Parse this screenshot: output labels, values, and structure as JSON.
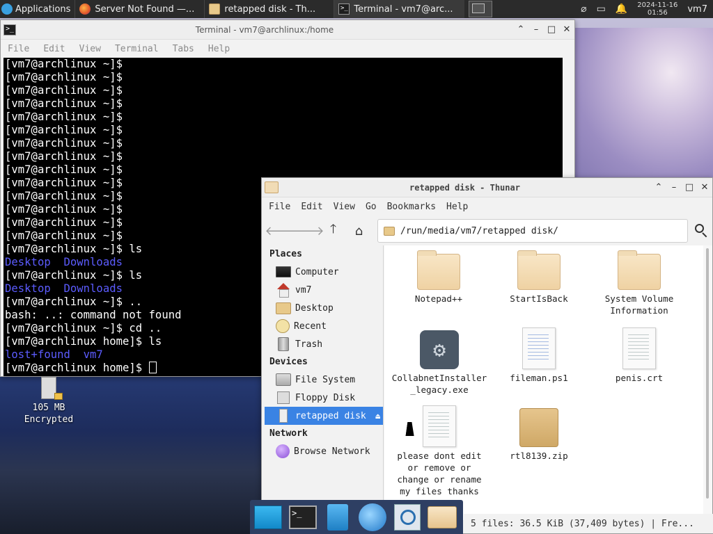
{
  "panel": {
    "apps_label": "Applications",
    "tasks": [
      {
        "label": "Server Not Found —..."
      },
      {
        "label": "retapped disk - Th..."
      },
      {
        "label": "Terminal - vm7@arc..."
      }
    ],
    "clock_date": "2024-11-16",
    "clock_time": "01:56",
    "user": "vm7"
  },
  "terminal": {
    "title": "Terminal - vm7@archlinux:/home",
    "menu": [
      "File",
      "Edit",
      "View",
      "Terminal",
      "Tabs",
      "Help"
    ],
    "lines": [
      {
        "text": "[vm7@archlinux ~]$",
        "blue": false
      },
      {
        "text": "[vm7@archlinux ~]$",
        "blue": false
      },
      {
        "text": "[vm7@archlinux ~]$",
        "blue": false
      },
      {
        "text": "[vm7@archlinux ~]$",
        "blue": false
      },
      {
        "text": "[vm7@archlinux ~]$",
        "blue": false
      },
      {
        "text": "[vm7@archlinux ~]$",
        "blue": false
      },
      {
        "text": "[vm7@archlinux ~]$",
        "blue": false
      },
      {
        "text": "[vm7@archlinux ~]$",
        "blue": false
      },
      {
        "text": "[vm7@archlinux ~]$",
        "blue": false
      },
      {
        "text": "[vm7@archlinux ~]$",
        "blue": false
      },
      {
        "text": "[vm7@archlinux ~]$",
        "blue": false
      },
      {
        "text": "[vm7@archlinux ~]$",
        "blue": false
      },
      {
        "text": "[vm7@archlinux ~]$",
        "blue": false
      },
      {
        "text": "[vm7@archlinux ~]$",
        "blue": false
      },
      {
        "text": "[vm7@archlinux ~]$ ls",
        "blue": false
      },
      {
        "text": "Desktop  Downloads",
        "blue": true
      },
      {
        "text": "[vm7@archlinux ~]$ ls",
        "blue": false
      },
      {
        "text": "Desktop  Downloads",
        "blue": true
      },
      {
        "text": "[vm7@archlinux ~]$ ..",
        "blue": false
      },
      {
        "text": "bash: ..: command not found",
        "blue": false
      },
      {
        "text": "[vm7@archlinux ~]$ cd ..",
        "blue": false
      },
      {
        "text": "[vm7@archlinux home]$ ls",
        "blue": false
      },
      {
        "text": "lost+found  vm7",
        "blue": true
      }
    ],
    "prompt": "[vm7@archlinux home]$ "
  },
  "thunar": {
    "title": "retapped disk - Thunar",
    "menu": [
      "File",
      "Edit",
      "View",
      "Go",
      "Bookmarks",
      "Help"
    ],
    "path": "/run/media/vm7/retapped disk/",
    "sidebar": {
      "places_head": "Places",
      "places": [
        "Computer",
        "vm7",
        "Desktop",
        "Recent",
        "Trash"
      ],
      "devices_head": "Devices",
      "devices": [
        "File System",
        "Floppy Disk",
        "retapped disk"
      ],
      "network_head": "Network",
      "network": [
        "Browse Network"
      ]
    },
    "files": [
      {
        "name": "Notepad++",
        "kind": "folder"
      },
      {
        "name": "StartIsBack",
        "kind": "folder"
      },
      {
        "name": "System Volume Information",
        "kind": "folder"
      },
      {
        "name": "CollabnetInstaller_legacy.exe",
        "kind": "exe"
      },
      {
        "name": "fileman.ps1",
        "kind": "code"
      },
      {
        "name": "penis.crt",
        "kind": "doc"
      },
      {
        "name": "please dont edit or remove or change or rename my files thanks ...txt",
        "kind": "doc"
      },
      {
        "name": "rtl8139.zip",
        "kind": "zip"
      }
    ],
    "status": "5 files: 36.5 KiB (37,409 bytes)  |  Fre..."
  },
  "desktop_icon": {
    "line1": "105 MB",
    "line2": "Encrypted"
  }
}
